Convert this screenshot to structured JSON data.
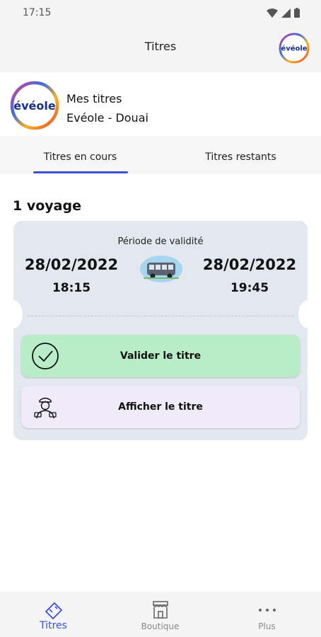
{
  "status_bar": {
    "time": "17:15"
  },
  "header": {
    "title": "Titres",
    "logo_text": "évéole"
  },
  "network": {
    "logo_text": "évéole",
    "line1": "Mes titres",
    "line2": "Evéole - Douai"
  },
  "tabs": [
    {
      "label": "Titres en cours",
      "active": true
    },
    {
      "label": "Titres restants",
      "active": false
    }
  ],
  "trips": {
    "count_label": "1 voyage"
  },
  "ticket": {
    "validity_label": "Période de validité",
    "start_date": "28/02/2022",
    "start_time": "18:15",
    "end_date": "28/02/2022",
    "end_time": "19:45",
    "validate_label": "Valider le titre",
    "show_label": "Afficher le titre"
  },
  "bottom_nav": [
    {
      "label": "Titres",
      "icon": "ticket-icon",
      "active": true
    },
    {
      "label": "Boutique",
      "icon": "shop-icon",
      "active": false
    },
    {
      "label": "Plus",
      "icon": "more-icon",
      "active": false
    }
  ],
  "colors": {
    "accent": "#3d4fd6",
    "validate_bg": "#b9edc8",
    "show_bg": "#efebf9",
    "ticket_bg": "#e3e7f0"
  }
}
